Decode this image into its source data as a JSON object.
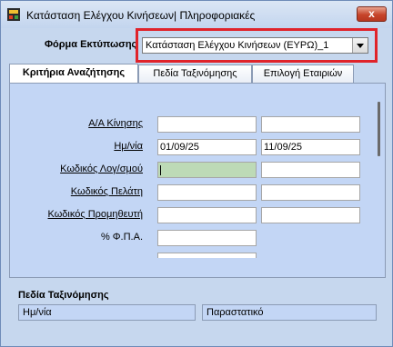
{
  "window": {
    "title": "Κατάσταση Ελέγχου Κινήσεων| Πληροφοριακές",
    "close_label": "x"
  },
  "form": {
    "label": "Φόρμα Εκτύπωσης",
    "selected": "Κατάσταση Ελέγχου Κινήσεων (ΕΥΡΩ)_1"
  },
  "tabs": [
    {
      "label": "Κριτήρια Αναζήτησης",
      "active": true
    },
    {
      "label": "Πεδία Ταξινόμησης",
      "active": false
    },
    {
      "label": "Επιλογή Εταιριών",
      "active": false
    }
  ],
  "criteria": {
    "aa_kinisis": {
      "label": "Α/Α Κίνησης",
      "from": "",
      "to": ""
    },
    "date": {
      "label": "Ημ/νία",
      "from": "01/09/25",
      "to": "11/09/25"
    },
    "account_code": {
      "label": "Κωδικός Λογ/σμού",
      "from": "",
      "to": ""
    },
    "customer_code": {
      "label": "Κωδικός Πελάτη",
      "from": "",
      "to": ""
    },
    "supplier_code": {
      "label": "Κωδικός Προμηθευτή",
      "from": "",
      "to": ""
    },
    "vat": {
      "label": "% Φ.Π.Α.",
      "value": ""
    }
  },
  "sorting": {
    "title": "Πεδία Ταξινόμησης",
    "field1": "Ημ/νία",
    "field2": "Παραστατικό"
  },
  "colors": {
    "highlight": "#e0232a",
    "panel": "#c3d6f5",
    "active_field": "#bddab6"
  }
}
